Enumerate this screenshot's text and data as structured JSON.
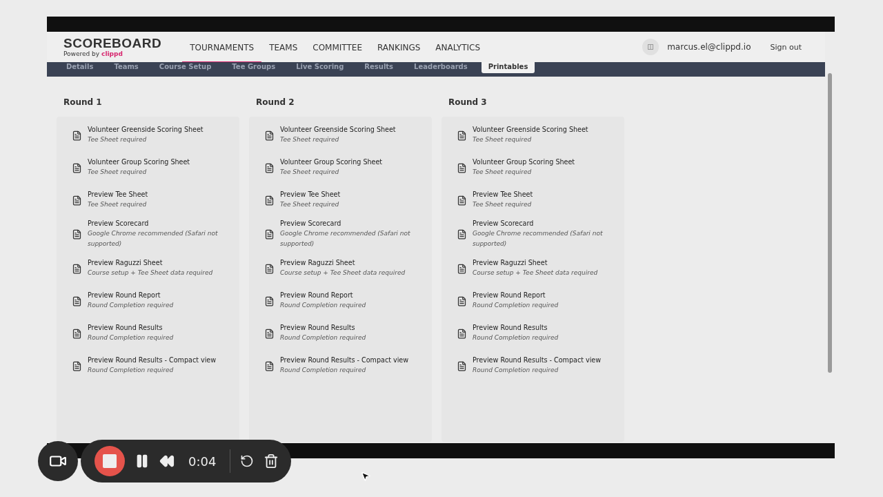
{
  "brand": {
    "name": "SCOREBOARD",
    "powered_by": "Powered by",
    "powered_brand": "clippd"
  },
  "nav": [
    {
      "label": "TOURNAMENTS",
      "selected": true
    },
    {
      "label": "TEAMS",
      "selected": false
    },
    {
      "label": "COMMITTEE",
      "selected": false
    },
    {
      "label": "RANKINGS",
      "selected": false
    },
    {
      "label": "ANALYTICS",
      "selected": false
    }
  ],
  "user": {
    "email": "marcus.el@clippd.io",
    "sign_out": "Sign out"
  },
  "tabs": [
    {
      "label": "Details",
      "selected": false
    },
    {
      "label": "Teams",
      "selected": false
    },
    {
      "label": "Course Setup",
      "selected": false
    },
    {
      "label": "Tee Groups",
      "selected": false
    },
    {
      "label": "Live Scoring",
      "selected": false
    },
    {
      "label": "Results",
      "selected": false
    },
    {
      "label": "Leaderboards",
      "selected": false
    },
    {
      "label": "Printables",
      "selected": true
    }
  ],
  "rounds": [
    {
      "title": "Round 1",
      "items": [
        {
          "title": "Volunteer Greenside Scoring Sheet",
          "note": "Tee Sheet required"
        },
        {
          "title": "Volunteer Group Scoring Sheet",
          "note": "Tee Sheet required"
        },
        {
          "title": "Preview Tee Sheet",
          "note": "Tee Sheet required"
        },
        {
          "title": "Preview Scorecard",
          "note": "Google Chrome recommended (Safari not supported)"
        },
        {
          "title": "Preview Raguzzi Sheet",
          "note": "Course setup + Tee Sheet data required"
        },
        {
          "title": "Preview Round Report",
          "note": "Round Completion required"
        },
        {
          "title": "Preview Round Results",
          "note": "Round Completion required"
        },
        {
          "title": "Preview Round Results - Compact view",
          "note": "Round Completion required"
        }
      ]
    },
    {
      "title": "Round 2",
      "items": [
        {
          "title": "Volunteer Greenside Scoring Sheet",
          "note": "Tee Sheet required"
        },
        {
          "title": "Volunteer Group Scoring Sheet",
          "note": "Tee Sheet required"
        },
        {
          "title": "Preview Tee Sheet",
          "note": "Tee Sheet required"
        },
        {
          "title": "Preview Scorecard",
          "note": "Google Chrome recommended (Safari not supported)"
        },
        {
          "title": "Preview Raguzzi Sheet",
          "note": "Course setup + Tee Sheet data required"
        },
        {
          "title": "Preview Round Report",
          "note": "Round Completion required"
        },
        {
          "title": "Preview Round Results",
          "note": "Round Completion required"
        },
        {
          "title": "Preview Round Results - Compact view",
          "note": "Round Completion required"
        }
      ]
    },
    {
      "title": "Round 3",
      "items": [
        {
          "title": "Volunteer Greenside Scoring Sheet",
          "note": "Tee Sheet required"
        },
        {
          "title": "Volunteer Group Scoring Sheet",
          "note": "Tee Sheet required"
        },
        {
          "title": "Preview Tee Sheet",
          "note": "Tee Sheet required"
        },
        {
          "title": "Preview Scorecard",
          "note": "Google Chrome recommended (Safari not supported)"
        },
        {
          "title": "Preview Raguzzi Sheet",
          "note": "Course setup + Tee Sheet data required"
        },
        {
          "title": "Preview Round Report",
          "note": "Round Completion required"
        },
        {
          "title": "Preview Round Results",
          "note": "Round Completion required"
        },
        {
          "title": "Preview Round Results - Compact view",
          "note": "Round Completion required"
        }
      ]
    }
  ],
  "recorder": {
    "time": "0:04"
  }
}
